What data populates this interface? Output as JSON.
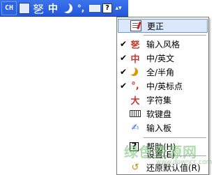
{
  "langbar": {
    "lang": "CH",
    "zh_char": "中",
    "punct": "°,",
    "help": "?",
    "more": "▴▾"
  },
  "menu": {
    "items": [
      {
        "label": "更正",
        "icon": "correct-icon",
        "checked": false,
        "selected": true
      },
      {
        "label": "输入风格",
        "icon": "input-style-icon",
        "glyph": "㐐",
        "checked": true
      },
      {
        "label": "中/英文",
        "icon": "chinese-english-icon",
        "glyph": "中",
        "checked": true
      },
      {
        "label": "全/半角",
        "icon": "moon-icon",
        "checked": true
      },
      {
        "label": "中/英标点",
        "icon": "punctuation-icon",
        "glyph": "°,",
        "checked": true
      },
      {
        "label": "字符集",
        "icon": "charset-icon",
        "glyph": "大",
        "checked": false
      },
      {
        "label": "软键盘",
        "icon": "keyboard-icon",
        "checked": false
      },
      {
        "label": "输入板",
        "icon": "input-pad-icon",
        "glyph": "✍",
        "checked": false
      },
      {
        "label": "帮助(H)",
        "icon": "help-icon",
        "glyph": "?",
        "checked": false
      },
      {
        "label": "设置(E)",
        "icon": "",
        "checked": false
      },
      {
        "label": "还原默认值(R)",
        "icon": "restore-icon",
        "glyph": "↺",
        "checked": false
      }
    ],
    "check_glyph": "✔"
  },
  "watermark": {
    "text": "绿色资源网",
    "url": "www.downcc.com"
  },
  "colors": {
    "langbar": "#2457d6",
    "selection": "#dbe8fb",
    "accent_red": "#c0392b"
  }
}
